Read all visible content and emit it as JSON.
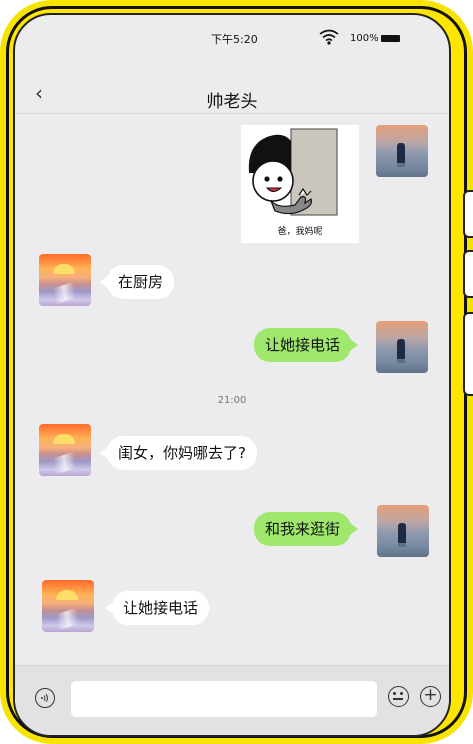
{
  "status_bar": {
    "time": "下午5:20",
    "battery": "100%"
  },
  "header": {
    "back": "‹",
    "title": "帅老头"
  },
  "messages": {
    "m0_sticker_caption": "爸，我妈呢",
    "m1": "在厨房",
    "m2": "让她接电话",
    "timestamp": "21:00",
    "m3": "闺女，你妈哪去了?",
    "m4": "和我来逛街",
    "m5": "让她接电话"
  },
  "input_bar": {
    "voice_icon": "voice-icon",
    "emoji_icon": "emoji-icon",
    "plus_icon": "plus-icon",
    "plus_glyph": "+"
  },
  "colors": {
    "frame": "#ffe600",
    "screen_bg": "#ececee",
    "bubble_green": "#9fe86d",
    "bubble_white": "#ffffff"
  }
}
